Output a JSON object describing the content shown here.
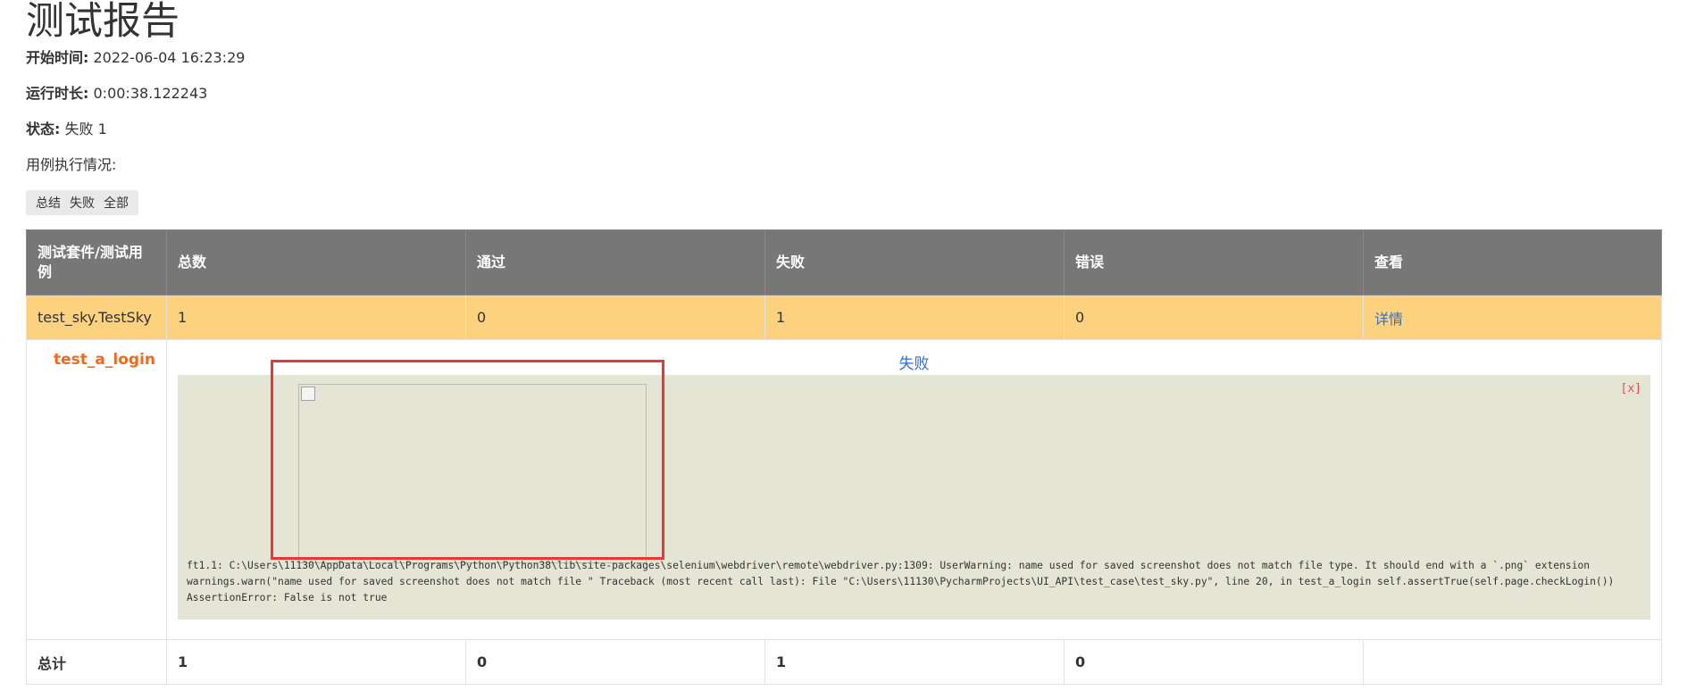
{
  "report": {
    "title": "测试报告",
    "start_time_label": "开始时间:",
    "start_time_value": "2022-06-04 16:23:29",
    "duration_label": "运行时长:",
    "duration_value": "0:00:38.122243",
    "status_label": "状态:",
    "status_value": "失败 1",
    "execution_label": "用例执行情况:"
  },
  "filters": [
    "总结",
    "失败",
    "全部"
  ],
  "table": {
    "headers": [
      "测试套件/测试用例",
      "总数",
      "通过",
      "失败",
      "错误",
      "查看"
    ],
    "suite": {
      "name": "test_sky.TestSky",
      "total": "1",
      "pass": "0",
      "fail": "1",
      "error": "0",
      "view_label": "详情"
    },
    "case": {
      "name": "test_a_login",
      "status": "失败",
      "close_label": "[x]",
      "log": "ft1.1: C:\\Users\\11130\\AppData\\Local\\Programs\\Python\\Python38\\lib\\site-packages\\selenium\\webdriver\\remote\\webdriver.py:1309: UserWarning: name used for saved screenshot does not match file type. It should end with a `.png` extension warnings.warn(\"name used for saved screenshot does not match file \" Traceback (most recent call last): File \"C:\\Users\\11130\\PycharmProjects\\UI_API\\test_case\\test_sky.py\", line 20, in test_a_login self.assertTrue(self.page.checkLogin()) AssertionError: False is not true"
    },
    "total": {
      "label": "总计",
      "total": "1",
      "pass": "0",
      "fail": "1",
      "error": "0"
    }
  },
  "colors": {
    "header_bg": "#777777",
    "suite_row_bg": "#fcd27f",
    "case_name": "#ee6a1d",
    "link": "#2f6fd0",
    "popup_bg": "#e5e5d6",
    "highlight_border": "#e53935"
  }
}
